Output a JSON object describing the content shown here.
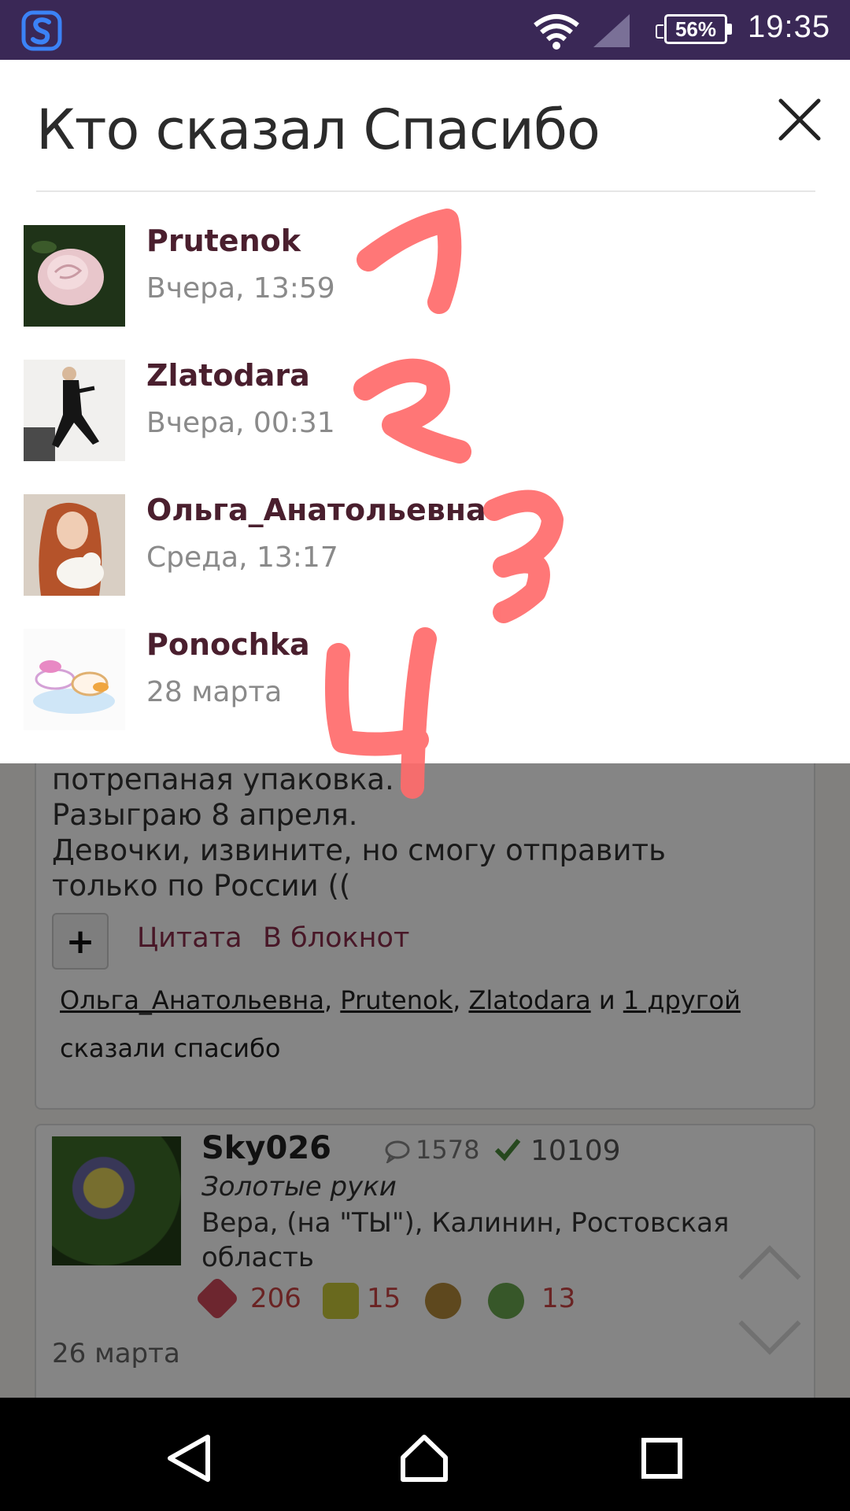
{
  "status_bar": {
    "battery": "56%",
    "time": "19:35",
    "icons": [
      "app-logo-icon",
      "wifi-icon",
      "signal-icon",
      "battery-icon"
    ]
  },
  "modal": {
    "title": "Кто сказал Спасибо",
    "close_icon": "close-icon",
    "items": [
      {
        "name": "Prutenok",
        "time": "Вчера, 13:59"
      },
      {
        "name": "Zlatodara",
        "time": "Вчера, 00:31"
      },
      {
        "name": "Ольга_Анатольевна",
        "time": "Среда, 13:17"
      },
      {
        "name": "Ponochka",
        "time": "28 марта"
      }
    ],
    "annotations": [
      "1",
      "2",
      "3",
      "4"
    ],
    "annotation_color": "#ff6b6b"
  },
  "background_post": {
    "text_lines": [
      "потрепаная упаковка.",
      "Разыграю 8 апреля.",
      "Девочки, извините, но смогу отправить",
      "только по России (("
    ],
    "actions": {
      "plus": "+",
      "quote": "Цитата",
      "notepad": "В блокнот"
    },
    "thanks": {
      "user1": "Ольга_Анатольевна",
      "sep1": ", ",
      "user2": "Prutenok",
      "sep2": ", ",
      "user3": "Zlatodara",
      "and": " и ",
      "others": "1 другой",
      "tail": "сказали спасибо"
    }
  },
  "next_post": {
    "username": "Sky026",
    "comments": "1578",
    "checks": "10109",
    "rank": "Золотые руки",
    "location": "Вера, (на \"ТЫ\"), Калинин, Ростовская область",
    "badges": {
      "hearts": "206",
      "votes": "15",
      "likes": "13"
    },
    "date": "26 марта"
  },
  "nav_bar": {
    "icons": [
      "back-icon",
      "home-icon",
      "recents-icon"
    ]
  }
}
